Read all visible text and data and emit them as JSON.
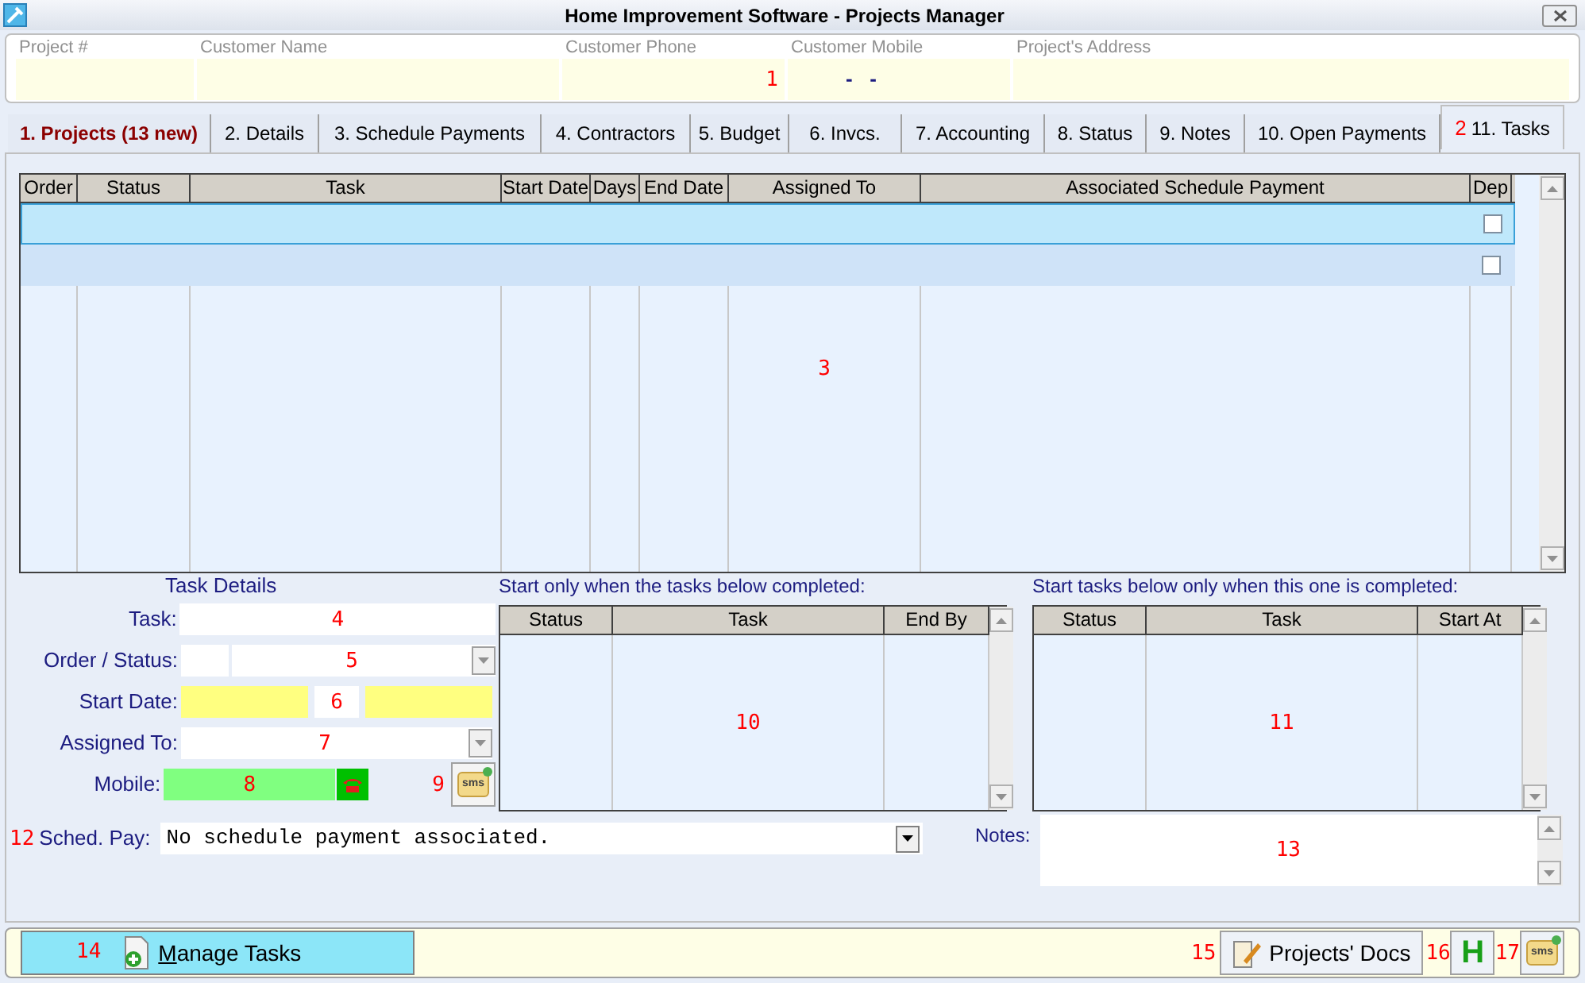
{
  "window": {
    "title": "Home Improvement Software - Projects Manager"
  },
  "header_fields": [
    {
      "label": "Project #"
    },
    {
      "label": "Customer Name"
    },
    {
      "label": "Customer Phone",
      "marker": "1"
    },
    {
      "label": "Customer Mobile",
      "value": "-   -"
    },
    {
      "label": "Project's Address"
    }
  ],
  "tabs": [
    {
      "label": "1. Projects (13 new)",
      "selected": false,
      "alert": true
    },
    {
      "label": "2. Details",
      "selected": false,
      "alert": false
    },
    {
      "label": "3. Schedule Payments",
      "selected": false,
      "alert": false
    },
    {
      "label": "4. Contractors",
      "selected": false,
      "alert": false
    },
    {
      "label": "5. Budget",
      "selected": false,
      "alert": false
    },
    {
      "label": "6. Invcs.",
      "selected": false,
      "alert": false
    },
    {
      "label": "7. Accounting",
      "selected": false,
      "alert": false
    },
    {
      "label": "8. Status",
      "selected": false,
      "alert": false
    },
    {
      "label": "9. Notes",
      "selected": false,
      "alert": false
    },
    {
      "label": "10. Open Payments",
      "selected": false,
      "alert": false
    },
    {
      "label": "11. Tasks",
      "selected": true,
      "alert": false,
      "marker": "2"
    }
  ],
  "grid": {
    "columns": [
      "Order",
      "Status",
      "Task",
      "Start Date",
      "Days",
      "End Date",
      "Assigned To",
      "Associated Schedule Payment",
      "Dep"
    ],
    "rows": [
      {
        "selected": true,
        "dep": false
      },
      {
        "selected": false,
        "dep": false
      }
    ],
    "marker": "3"
  },
  "task_details": {
    "title": "Task Details",
    "fields": [
      {
        "kind": "text",
        "label": "Task:",
        "marker": "4"
      },
      {
        "kind": "order_status",
        "label": "Order / Status:",
        "marker": "5"
      },
      {
        "kind": "date",
        "label": "Start Date:",
        "marker": "6"
      },
      {
        "kind": "combo",
        "label": "Assigned To:",
        "marker": "7"
      },
      {
        "kind": "mobile",
        "label": "Mobile:",
        "marker": "8",
        "button_marker": "9",
        "button_label": "sms"
      }
    ]
  },
  "sched_pay": {
    "marker": "12",
    "label": "Sched. Pay:",
    "value": "No schedule payment associated."
  },
  "dependency_panels": [
    {
      "title": "Start only when the tasks below completed:",
      "columns": [
        "Status",
        "Task",
        "End By"
      ],
      "marker": "10"
    },
    {
      "title": "Start tasks below only when this one is completed:",
      "columns": [
        "Status",
        "Task",
        "Start At"
      ],
      "marker": "11"
    }
  ],
  "notes": {
    "label": "Notes:",
    "marker": "13"
  },
  "bottom_bar": {
    "manage": {
      "marker": "14",
      "label": "Manage Tasks",
      "mnemonic": true
    },
    "docs": {
      "marker": "15",
      "label": "Projects' Docs"
    },
    "help": {
      "marker": "16",
      "label": "H"
    },
    "sms": {
      "marker": "17",
      "label": "sms"
    }
  }
}
